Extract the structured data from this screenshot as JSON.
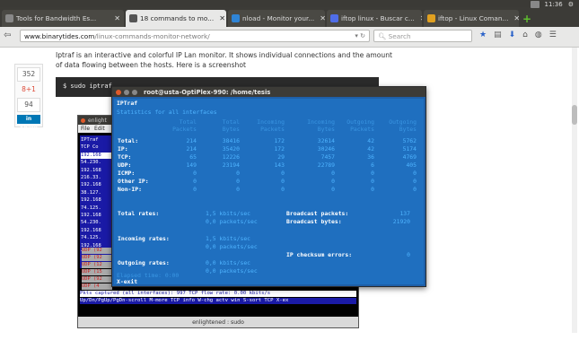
{
  "browser": {
    "tabs": [
      {
        "label": "Tools for Bandwidth Es...",
        "active": false,
        "favicon_color": "#888888"
      },
      {
        "label": "18 commands to mo...",
        "active": true,
        "favicon_color": "#555555"
      },
      {
        "label": "nload - Monitor your...",
        "active": false,
        "favicon_color": "#2f84d6"
      },
      {
        "label": "iftop linux - Buscar c...",
        "active": false,
        "favicon_color": "#4f6de8"
      },
      {
        "label": "iftop - Linux Coman...",
        "active": false,
        "favicon_color": "#e0a020"
      }
    ],
    "new_tab": "+",
    "clock": "11:36",
    "url_host": "www.binarytides.com",
    "url_path": "/linux-commands-monitor-network/",
    "search_placeholder": "Search"
  },
  "share": {
    "count_top": "352",
    "gplus": "8+1",
    "count_mid": "94",
    "linkedin": "in Share"
  },
  "article": {
    "text": "Iptraf is an interactive and colorful IP Lan monitor. It shows individual connections and the amount of data flowing between the hosts. Here is a screenshot",
    "code": "$ sudo iptraf"
  },
  "back_terminal": {
    "title": "enlightened : sudo",
    "menu": [
      "File",
      "Edit"
    ],
    "title_small": "enlight",
    "rows": [
      "IPTraf",
      " TCP Co",
      "192.168",
      "54.230.",
      "192.168",
      "216.33.",
      "192.168",
      "38.127.",
      "192.168",
      "74.125.",
      "192.168",
      "54.230.",
      "192.168",
      "74.125.",
      "192.168",
      " TCP:"
    ],
    "udp_rows": [
      "UDP (92",
      "UDP (92",
      "UDP (12",
      "UDP (15",
      "UDP (92",
      "UDP (4"
    ],
    "status1": "Pkts captured (all interfaces):   997  TCP flow rate:    0.00 kbits/s",
    "status2": "Up/Dn/PgUp/PgDn-scroll  M-more TCP info  W-chg actv win  S-sort TCP  X-ex"
  },
  "terminal": {
    "title": "root@usta-OptiPlex-990: /home/tesis",
    "app_name": "IPTraf",
    "subtitle": "Statistics for all interfaces",
    "headers": [
      [
        "Total",
        "Packets"
      ],
      [
        "Total",
        "Bytes"
      ],
      [
        "Incoming",
        "Packets"
      ],
      [
        "Incoming",
        "Bytes"
      ],
      [
        "Outgoing",
        "Packets"
      ],
      [
        "Outgoing",
        "Bytes"
      ]
    ],
    "rows": [
      {
        "label": "Total:",
        "vals": [
          "214",
          "38416",
          "172",
          "32614",
          "42",
          "5762"
        ]
      },
      {
        "label": "IP:",
        "vals": [
          "214",
          "35420",
          "172",
          "30246",
          "42",
          "5174"
        ]
      },
      {
        "label": "TCP:",
        "vals": [
          "65",
          "12226",
          "29",
          "7457",
          "36",
          "4769"
        ]
      },
      {
        "label": "UDP:",
        "vals": [
          "149",
          "23194",
          "143",
          "22789",
          "6",
          "405"
        ]
      },
      {
        "label": "ICMP:",
        "vals": [
          "0",
          "0",
          "0",
          "0",
          "0",
          "0"
        ]
      },
      {
        "label": "Other IP:",
        "vals": [
          "0",
          "0",
          "0",
          "0",
          "0",
          "0"
        ]
      },
      {
        "label": "Non-IP:",
        "vals": [
          "0",
          "0",
          "0",
          "0",
          "0",
          "0"
        ]
      }
    ],
    "total_rates_label": "Total rates:",
    "total_rates": [
      "1,5 kbits/sec",
      "0,0 packets/sec"
    ],
    "broadcast_packets_label": "Broadcast packets:",
    "broadcast_packets": "137",
    "broadcast_bytes_label": "Broadcast bytes:",
    "broadcast_bytes": "21920",
    "incoming_rates_label": "Incoming rates:",
    "incoming_rates": [
      "1,5 kbits/sec",
      "0,0 packets/sec"
    ],
    "checksum_label": "IP checksum errors:",
    "checksum": "0",
    "outgoing_rates_label": "Outgoing rates:",
    "outgoing_rates": [
      "0,0 kbits/sec",
      "0,0 packets/sec"
    ],
    "elapsed": "Elapsed time:   0:00",
    "exit": "X-exit"
  }
}
